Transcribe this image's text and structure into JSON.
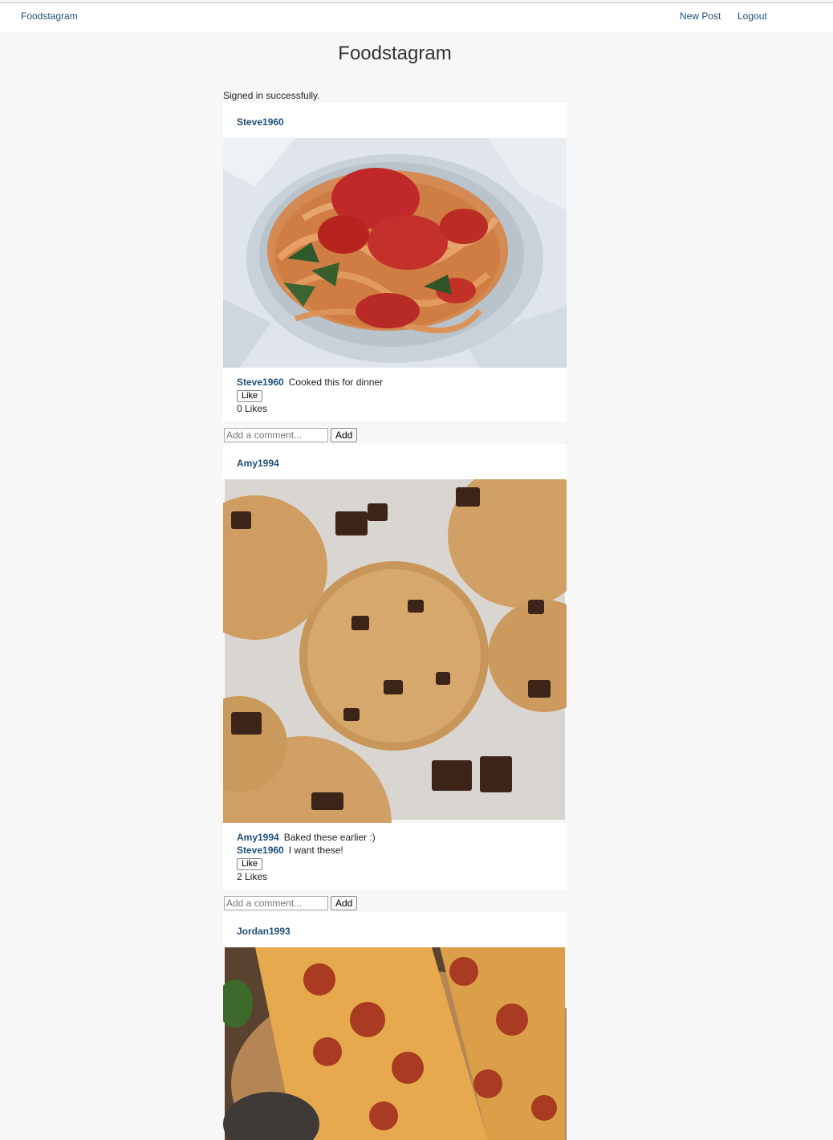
{
  "nav": {
    "brand": "Foodstagram",
    "new_post": "New Post",
    "logout": "Logout"
  },
  "page": {
    "title": "Foodstagram",
    "flash": "Signed in successfully."
  },
  "posts": [
    {
      "author": "Steve1960",
      "caption_author": "Steve1960",
      "caption": "Cooked this for dinner",
      "comments": [],
      "like_label": "Like",
      "likes": "0 Likes",
      "comment_placeholder": "Add a comment...",
      "add_label": "Add"
    },
    {
      "author": "Amy1994",
      "caption_author": "Amy1994",
      "caption": "Baked these earlier :)",
      "comments": [
        {
          "author": "Steve1960",
          "text": "I want these!"
        }
      ],
      "like_label": "Like",
      "likes": "2 Likes",
      "comment_placeholder": "Add a comment...",
      "add_label": "Add"
    },
    {
      "author": "Jordan1993"
    }
  ]
}
